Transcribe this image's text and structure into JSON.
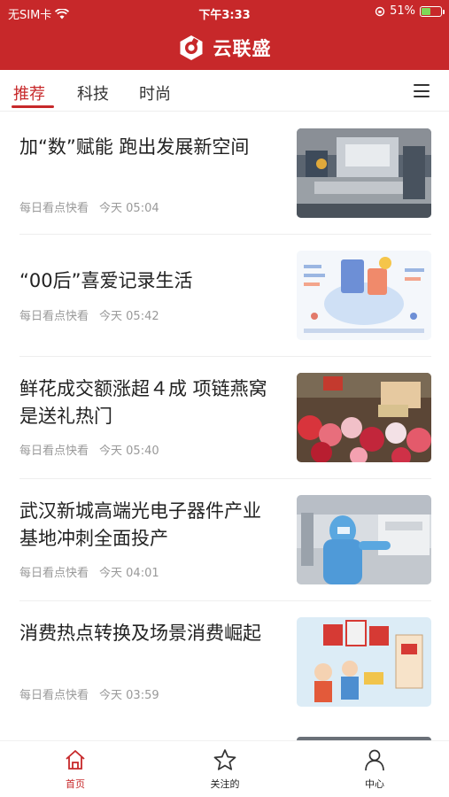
{
  "status_bar": {
    "carrier": "无SIM卡",
    "time": "下午3:33",
    "battery_percent": 51,
    "battery_label": "51%"
  },
  "app": {
    "title": "云联盛",
    "brand_color": "#c7282a"
  },
  "tabs": [
    {
      "label": "推荐",
      "active": true
    },
    {
      "label": "科技",
      "active": false
    },
    {
      "label": "时尚",
      "active": false
    }
  ],
  "news": [
    {
      "title": "加“数”赋能 跑出发展新空间",
      "source": "每日看点快看",
      "time": "今天 05:04",
      "image": "factory-photo"
    },
    {
      "title": "“00后”喜爱记录生活",
      "source": "每日看点快看",
      "time": "今天 05:42",
      "image": "infographic"
    },
    {
      "title": "鲜花成交额涨超４成 项链燕窝是送礼热门",
      "source": "每日看点快看",
      "time": "今天 05:40",
      "image": "flower-market-photo"
    },
    {
      "title": "武汉新城高端光电子器件产业基地冲刺全面投产",
      "source": "每日看点快看",
      "time": "今天 04:01",
      "image": "lab-worker-photo"
    },
    {
      "title": "消费热点转换及场景消费崛起",
      "source": "每日看点快看",
      "time": "今天 03:59",
      "image": "cartoon-illustration"
    }
  ],
  "bottom_nav": [
    {
      "label": "首页",
      "icon": "home-icon",
      "active": true
    },
    {
      "label": "关注的",
      "icon": "star-icon",
      "active": false
    },
    {
      "label": "中心",
      "icon": "user-icon",
      "active": false
    }
  ]
}
